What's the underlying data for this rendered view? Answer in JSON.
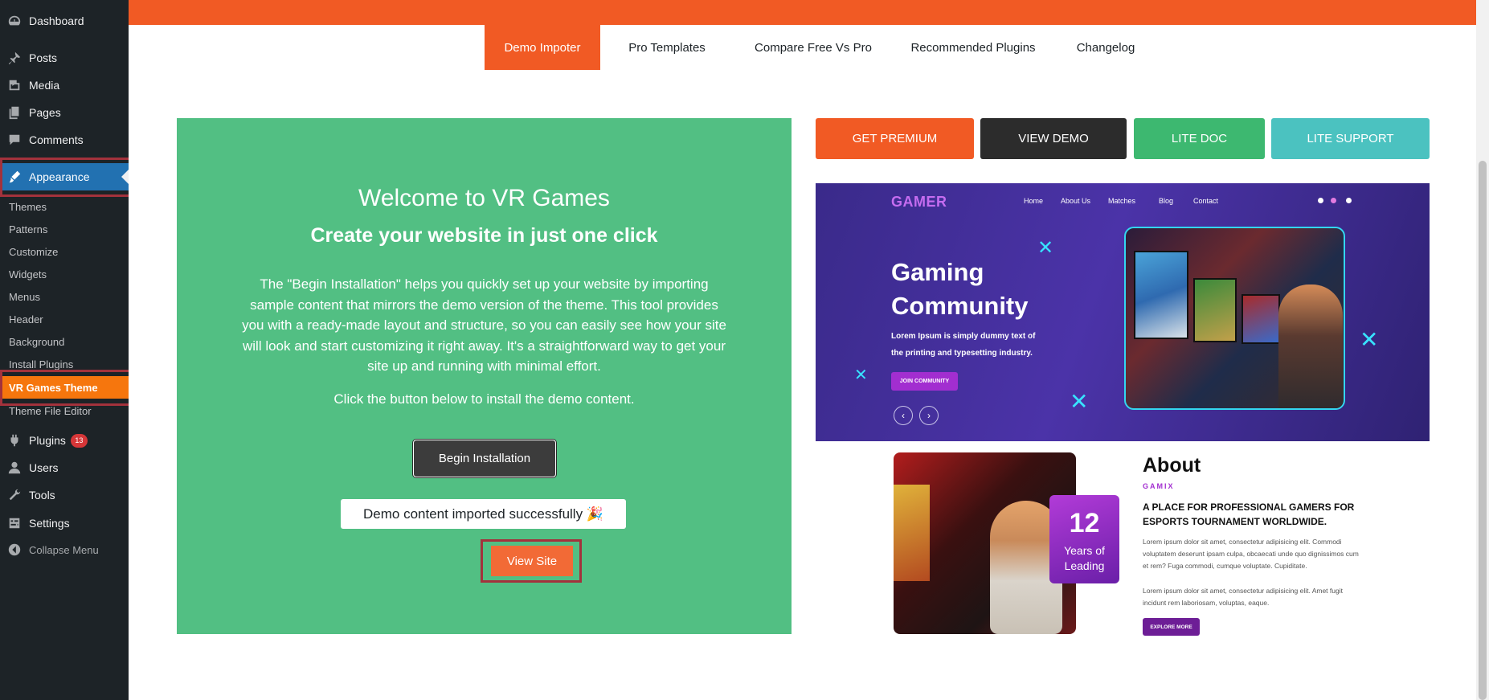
{
  "sidebar": {
    "menu": [
      {
        "label": "Dashboard",
        "icon": "dashboard-icon"
      },
      {
        "label": "Posts",
        "icon": "pin-icon"
      },
      {
        "label": "Media",
        "icon": "media-icon"
      },
      {
        "label": "Pages",
        "icon": "pages-icon"
      },
      {
        "label": "Comments",
        "icon": "comments-icon"
      },
      {
        "label": "Appearance",
        "icon": "paintbrush-icon"
      }
    ],
    "submenu": [
      "Themes",
      "Patterns",
      "Customize",
      "Widgets",
      "Menus",
      "Header",
      "Background",
      "Install Plugins",
      "VR Games Theme",
      "Theme File Editor"
    ],
    "menu_bottom": [
      {
        "label": "Plugins",
        "icon": "plugin-icon",
        "badge": "13"
      },
      {
        "label": "Users",
        "icon": "users-icon"
      },
      {
        "label": "Tools",
        "icon": "wrench-icon"
      },
      {
        "label": "Settings",
        "icon": "settings-icon"
      },
      {
        "label": "Collapse Menu",
        "icon": "collapse-icon"
      }
    ]
  },
  "tabs": [
    "Demo Impoter",
    "Pro Templates",
    "Compare Free Vs Pro",
    "Recommended Plugins",
    "Changelog"
  ],
  "welcome": {
    "title": "Welcome to VR Games",
    "subtitle": "Create your website in just one click",
    "description": "The \"Begin Installation\" helps you quickly set up your website by importing sample content that mirrors the demo version of the theme. This tool provides you with a ready-made layout and structure, so you can easily see how your site will look and start customizing it right away. It's a straightforward way to get your site up and running with minimal effort.",
    "click_text": "Click the button below to install the demo content.",
    "begin_button": "Begin Installation",
    "success_message": "Demo content imported successfully 🎉",
    "view_site_button": "View Site"
  },
  "actions": {
    "get_premium": "GET PREMIUM",
    "view_demo": "VIEW DEMO",
    "lite_doc": "LITE DOC",
    "lite_support": "LITE SUPPORT"
  },
  "preview": {
    "logo": "GAMER",
    "nav": [
      "Home",
      "About Us",
      "Matches",
      "Blog",
      "Contact"
    ],
    "headline_1": "Gaming",
    "headline_2": "Community",
    "description": "Lorem Ipsum is simply dummy text of the printing and typesetting industry.",
    "join_button": "JOIN COMMUNITY",
    "prev": "‹",
    "next": "›"
  },
  "about": {
    "title": "About",
    "kicker": "GAMIX",
    "heading": "A PLACE FOR PROFESSIONAL GAMERS FOR ESPORTS TOURNAMENT WORLDWIDE.",
    "para_1": "Lorem ipsum dolor sit amet, consectetur adipisicing elit. Commodi voluptatem deserunt ipsam culpa, obcaecati unde quo dignissimos cum et rem? Fuga commodi, cumque voluptate. Cupiditate.",
    "para_2": "Lorem ipsum dolor sit amet, consectetur adipisicing elit. Amet fugit incidunt rem laboriosam, voluptas, eaque.",
    "explore_button": "EXPLORE MORE",
    "years_number": "12",
    "years_label": "Years of Leading"
  },
  "colors": {
    "accent_orange": "#f15a24",
    "panel_green": "#52bf83",
    "wp_blue": "#2271b1",
    "highlight": "#a3323c"
  }
}
